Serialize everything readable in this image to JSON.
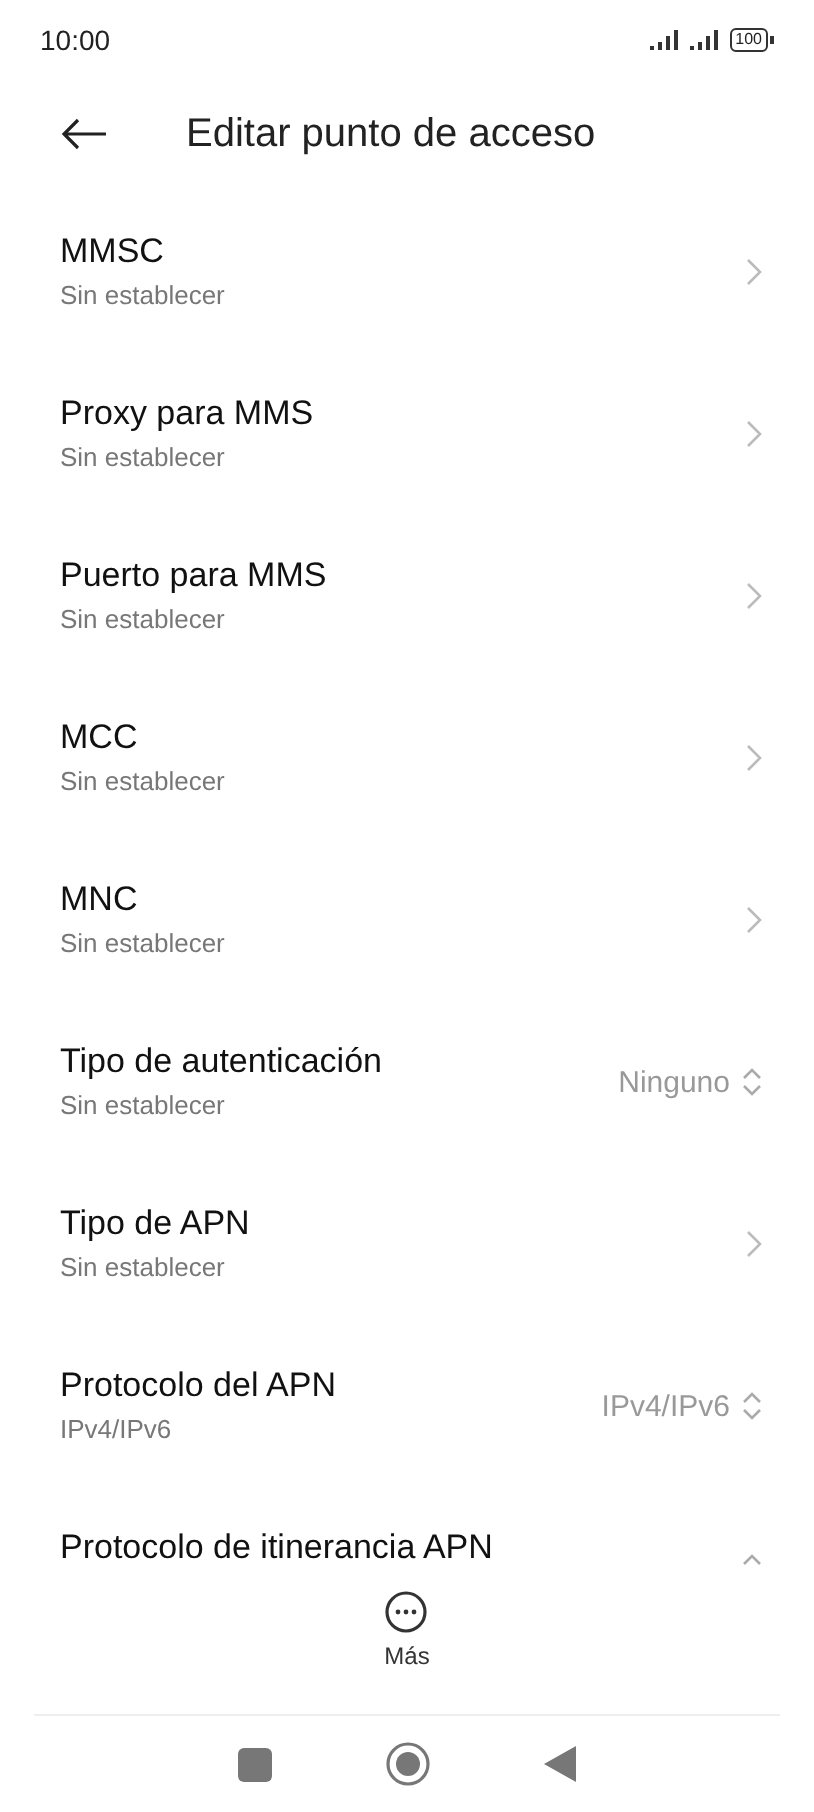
{
  "status_bar": {
    "time": "10:00",
    "battery": "100"
  },
  "header": {
    "title": "Editar punto de acceso"
  },
  "settings": [
    {
      "kind": "link",
      "title": "MMSC",
      "subtitle": "Sin establecer"
    },
    {
      "kind": "link",
      "title": "Proxy para MMS",
      "subtitle": "Sin establecer"
    },
    {
      "kind": "link",
      "title": "Puerto para MMS",
      "subtitle": "Sin establecer"
    },
    {
      "kind": "link",
      "title": "MCC",
      "subtitle": "Sin establecer"
    },
    {
      "kind": "link",
      "title": "MNC",
      "subtitle": "Sin establecer"
    },
    {
      "kind": "select",
      "title": "Tipo de autenticación",
      "subtitle": "Sin establecer",
      "value": "Ninguno"
    },
    {
      "kind": "link",
      "title": "Tipo de APN",
      "subtitle": "Sin establecer"
    },
    {
      "kind": "select",
      "title": "Protocolo del APN",
      "subtitle": "IPv4/IPv6",
      "value": "IPv4/IPv6"
    },
    {
      "kind": "select",
      "title": "Protocolo de itinerancia APN"
    }
  ],
  "more_button": {
    "label": "Más"
  }
}
